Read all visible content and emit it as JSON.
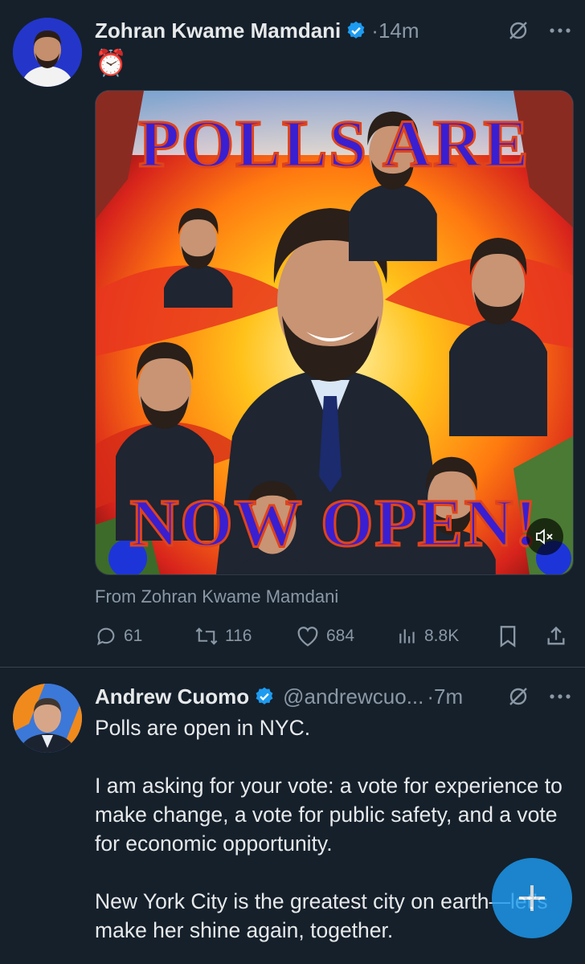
{
  "tweet1": {
    "author_name": "Zohran Kwame Mamdani",
    "separator": "·",
    "time": "14m",
    "text_emoji": "⏰",
    "media_text_top": "POLLS ARE",
    "media_text_bottom": "NOW OPEN!",
    "from_label": "From Zohran Kwame Mamdani",
    "stats": {
      "replies": "61",
      "reposts": "116",
      "likes": "684",
      "views": "8.8K"
    }
  },
  "tweet2": {
    "author_name": "Andrew Cuomo",
    "handle": "@andrewcuo...",
    "separator": "·",
    "time": "7m",
    "paragraphs": [
      "Polls are open in NYC.",
      "I am asking for your vote: a vote for experience to make change, a vote for public safety, and a vote for economic opportunity.",
      "New York City is the greatest city on earth—let’s make her shine again, together."
    ]
  },
  "colors": {
    "background": "#15202b",
    "accent": "#1d9bf0",
    "muted": "#8b98a5",
    "text": "#e7e9ea"
  }
}
